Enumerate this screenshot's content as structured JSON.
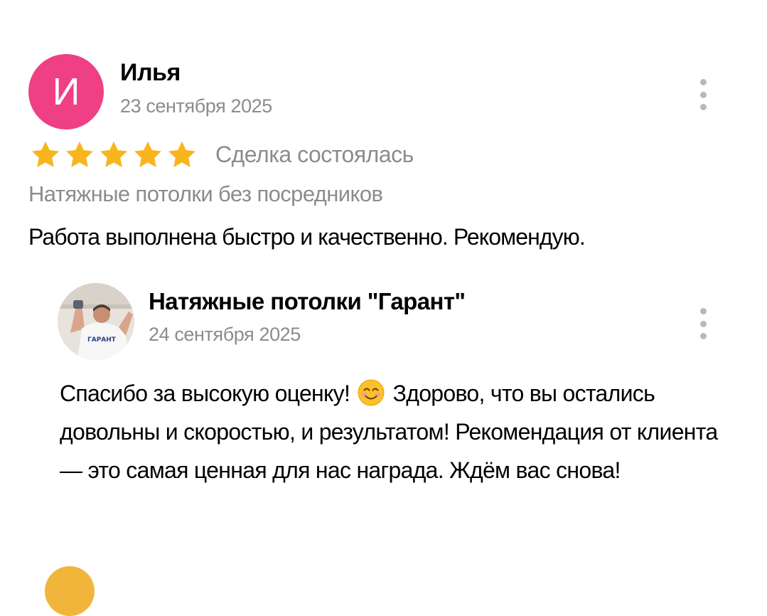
{
  "review": {
    "avatar_letter": "И",
    "author": "Илья",
    "date": "23 сентября 2025",
    "rating": 5,
    "rating_max": 5,
    "deal_status": "Сделка состоялась",
    "service": "Натяжные потолки без посредников",
    "text": "Работа выполнена быстро и качественно. Рекомендую."
  },
  "reply": {
    "author": "Натяжные потолки \"Гарант\"",
    "date": "24 сентября 2025",
    "text_before_emoji": "Спасибо за высокую оценку!",
    "emoji": "smiling-face-emoji",
    "text_after_emoji": "Здорово, что вы остались довольны и скоростью, и результатом! Рекомендация от клиента — это самая ценная для нас награда. Ждём вас снова!",
    "avatar_shirt_text": "ГАРАНТ"
  },
  "colors": {
    "avatar_background": "#ef3f85",
    "star": "#f8b51e",
    "muted_text": "#8c8c8c",
    "menu_dots": "#b8b8b8",
    "next_avatar": "#f2b53b"
  },
  "icons": {
    "star": "star-icon",
    "menu": "more-vertical-icon"
  }
}
